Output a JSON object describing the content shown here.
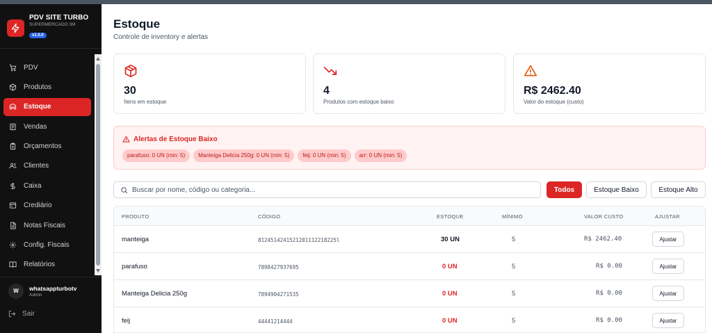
{
  "app": {
    "name": "PDV SITE TURBO",
    "subtitle": "SUPERMERCADO 3M",
    "version": "v1.0.0"
  },
  "sidebar": {
    "items": [
      {
        "label": "PDV",
        "icon": "cart-icon",
        "active": false
      },
      {
        "label": "Produtos",
        "icon": "package-icon",
        "active": false
      },
      {
        "label": "Estoque",
        "icon": "warehouse-icon",
        "active": true
      },
      {
        "label": "Vendas",
        "icon": "receipt-icon",
        "active": false
      },
      {
        "label": "Orçamentos",
        "icon": "clipboard-icon",
        "active": false
      },
      {
        "label": "Clientes",
        "icon": "users-icon",
        "active": false
      },
      {
        "label": "Caixa",
        "icon": "dollar-icon",
        "active": false
      },
      {
        "label": "Crediário",
        "icon": "credit-card-icon",
        "active": false
      },
      {
        "label": "Notas Fiscais",
        "icon": "document-icon",
        "active": false
      },
      {
        "label": "Config. Fiscais",
        "icon": "gear-icon",
        "active": false
      },
      {
        "label": "Relatórios",
        "icon": "book-icon",
        "active": false
      }
    ],
    "user": {
      "initial": "W",
      "name": "whatsappturbotv",
      "role": "Admin"
    },
    "logout_label": "Sair"
  },
  "header": {
    "title": "Estoque",
    "subtitle": "Controle de inventory e alertas"
  },
  "stats": [
    {
      "value": "30",
      "label": "Itens em estoque",
      "icon": "box-icon",
      "color": "#dc2626"
    },
    {
      "value": "4",
      "label": "Produtos com estoque baixo",
      "icon": "trending-down-icon",
      "color": "#dc2626"
    },
    {
      "value": "R$ 2462.40",
      "label": "Valor do estoque (custo)",
      "icon": "warning-triangle-icon",
      "color": "#ea580c"
    }
  ],
  "alert": {
    "title": "Alertas de Estoque Baixo",
    "items": [
      "parafuso: 0 UN (min: 5)",
      "Manteiga Delicia 250g: 0 UN (min: 5)",
      "feij: 0 UN (min: 5)",
      "arr: 0 UN (min: 5)"
    ]
  },
  "search": {
    "placeholder": "Buscar por nome, código ou categoria...",
    "value": ""
  },
  "filters": {
    "all": "Todos",
    "low": "Estoque Baixo",
    "high": "Estoque Alto",
    "active": "Todos"
  },
  "table": {
    "columns": [
      "PRODUTO",
      "CÓDIGO",
      "ESTOQUE",
      "MÍNIMO",
      "VALOR CUSTO",
      "AJUSTAR"
    ],
    "rows": [
      {
        "product": "manteiga",
        "code": "8124514241521201112218225l",
        "stock": "30 UN",
        "low": false,
        "min": "5",
        "cost": "R$ 2462.40",
        "action": "Ajustar"
      },
      {
        "product": "parafuso",
        "code": "7898427937695",
        "stock": "0 UN",
        "low": true,
        "min": "5",
        "cost": "R$ 0.00",
        "action": "Ajustar"
      },
      {
        "product": "Manteiga Delicia 250g",
        "code": "7894904271535",
        "stock": "0 UN",
        "low": true,
        "min": "5",
        "cost": "R$ 0.00",
        "action": "Ajustar"
      },
      {
        "product": "feij",
        "code": "44441214444",
        "stock": "0 UN",
        "low": true,
        "min": "5",
        "cost": "R$ 0.00",
        "action": "Ajustar"
      }
    ]
  },
  "colors": {
    "accent": "#dc2626",
    "sidebar_bg": "#111111",
    "version_badge": "#2563eb"
  }
}
